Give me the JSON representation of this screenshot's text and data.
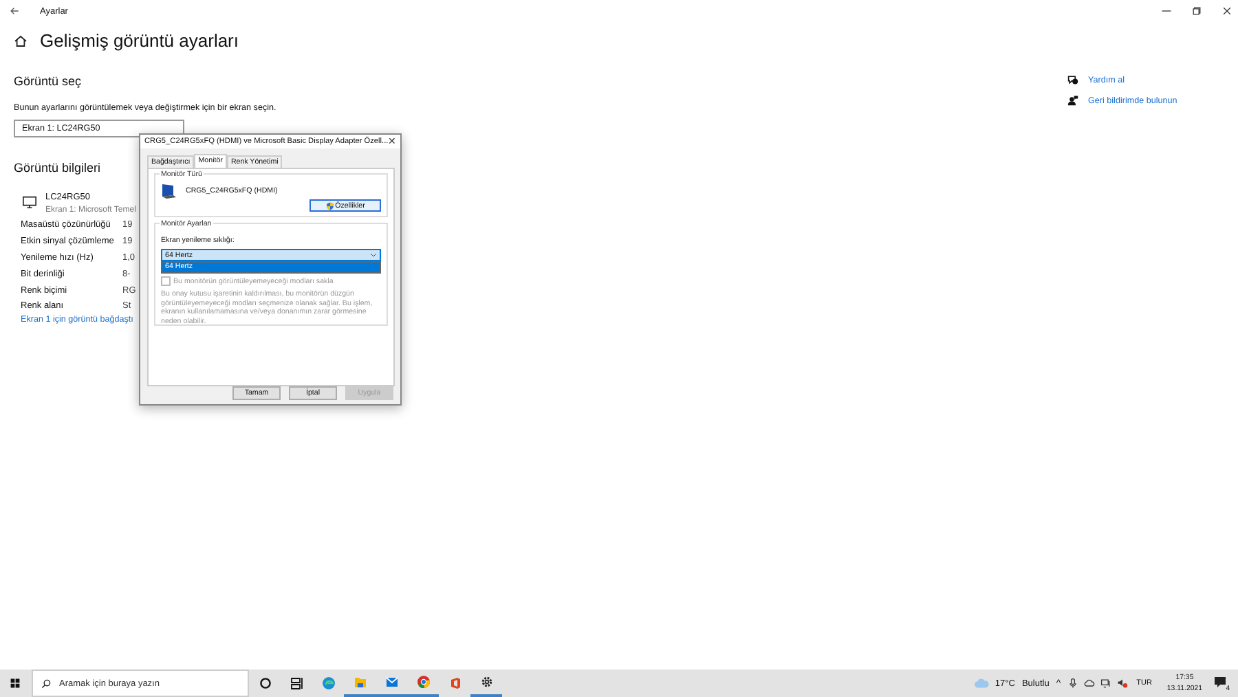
{
  "window": {
    "title": "Ayarlar"
  },
  "page": {
    "title": "Gelişmiş görüntü ayarları",
    "select_heading": "Görüntü seç",
    "select_hint": "Bunun ayarlarını görüntülemek veya değiştirmek için bir ekran seçin.",
    "display_dropdown": {
      "value": "Ekran 1: LC24RG50"
    },
    "info_heading": "Görüntü bilgileri",
    "monitor": {
      "name": "LC24RG50",
      "subtitle": "Ekran 1: Microsoft Temel"
    },
    "info_rows": [
      {
        "label": "Masaüstü çözünürlüğü",
        "value": "19"
      },
      {
        "label": "Etkin sinyal çözümleme",
        "value": "19"
      },
      {
        "label": "Yenileme hızı (Hz)",
        "value": "1,0"
      },
      {
        "label": "Bit derinliği",
        "value": "8-"
      },
      {
        "label": "Renk biçimi",
        "value": "RG"
      },
      {
        "label": "Renk alanı",
        "value": "St"
      }
    ],
    "adapter_link": "Ekran 1 için görüntü bağdaştı"
  },
  "help_links": [
    {
      "label": "Yardım al",
      "kind": "help"
    },
    {
      "label": "Geri bildirimde bulunun",
      "kind": "feedback"
    }
  ],
  "dialog": {
    "title": "CRG5_C24RG5xFQ (HDMI) ve Microsoft Basic Display Adapter Özell...",
    "close": "✕",
    "tabs": [
      {
        "label": "Bağdaştırıcı",
        "selected": false
      },
      {
        "label": "Monitör",
        "selected": true
      },
      {
        "label": "Renk Yönetimi",
        "selected": false
      }
    ],
    "monitor_type_group": "Monitör Türü",
    "monitor_name": "CRG5_C24RG5xFQ (HDMI)",
    "properties_button": "Özellikler",
    "settings_group": "Monitör Ayarları",
    "refresh_label": "Ekran yenileme sıklığı:",
    "refresh_dropdown": {
      "value": "64 Hertz",
      "expanded": true,
      "options": [
        {
          "label": "64 Hertz",
          "selected": true
        }
      ]
    },
    "hide_modes": {
      "label": "Bu monitörün görüntüleyemeyeceği modları sakla",
      "checked": false,
      "disabled": true
    },
    "description": "Bu onay kutusu işaretinin kaldırılması, bu monitörün düzgün görüntüleyemeyeceği modları seçmenize olanak sağlar. Bu işlem, ekranın kullanılamamasına ve/veya donanımın zarar görmesine neden olabilir.",
    "buttons": [
      {
        "label": "Tamam",
        "disabled": false
      },
      {
        "label": "İptal",
        "disabled": false
      },
      {
        "label": "Uygula",
        "disabled": true
      }
    ]
  },
  "taskbar": {
    "search_placeholder": "Aramak için buraya yazın",
    "apps": [
      {
        "kind": "cortana",
        "running": false
      },
      {
        "kind": "taskview",
        "running": false
      },
      {
        "kind": "edge",
        "running": false
      },
      {
        "kind": "explorer",
        "running": true
      },
      {
        "kind": "mail",
        "running": true
      },
      {
        "kind": "chrome",
        "running": true
      },
      {
        "kind": "office",
        "running": false
      },
      {
        "kind": "settings",
        "running": true
      }
    ],
    "weather": {
      "temperature": "17°C",
      "condition": "Bulutlu"
    },
    "tray_caret": "^",
    "language": "TUR",
    "time": "17:35",
    "date": "13.11.2021",
    "notifications": "4"
  }
}
